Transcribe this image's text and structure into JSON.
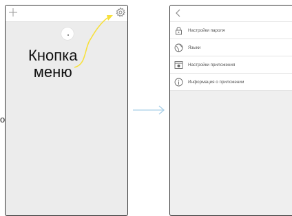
{
  "annotation": {
    "text": "Кнопка\nменю",
    "highlight_color": "#f7e03c"
  },
  "side_glyph": "o",
  "left_screen": {
    "icons": [
      "plus-icon",
      "gear-icon"
    ]
  },
  "flow_arrow_color": "#a9cfe8",
  "settings_menu": {
    "back_icon": "chevron-left-icon",
    "items": [
      {
        "label": "Настройки пароля",
        "icon": "lock-icon"
      },
      {
        "label": "Языки",
        "icon": "globe-icon"
      },
      {
        "label": "Настройки приложения",
        "icon": "app-settings-icon"
      },
      {
        "label": "Информация о приложении",
        "icon": "info-icon"
      }
    ]
  }
}
